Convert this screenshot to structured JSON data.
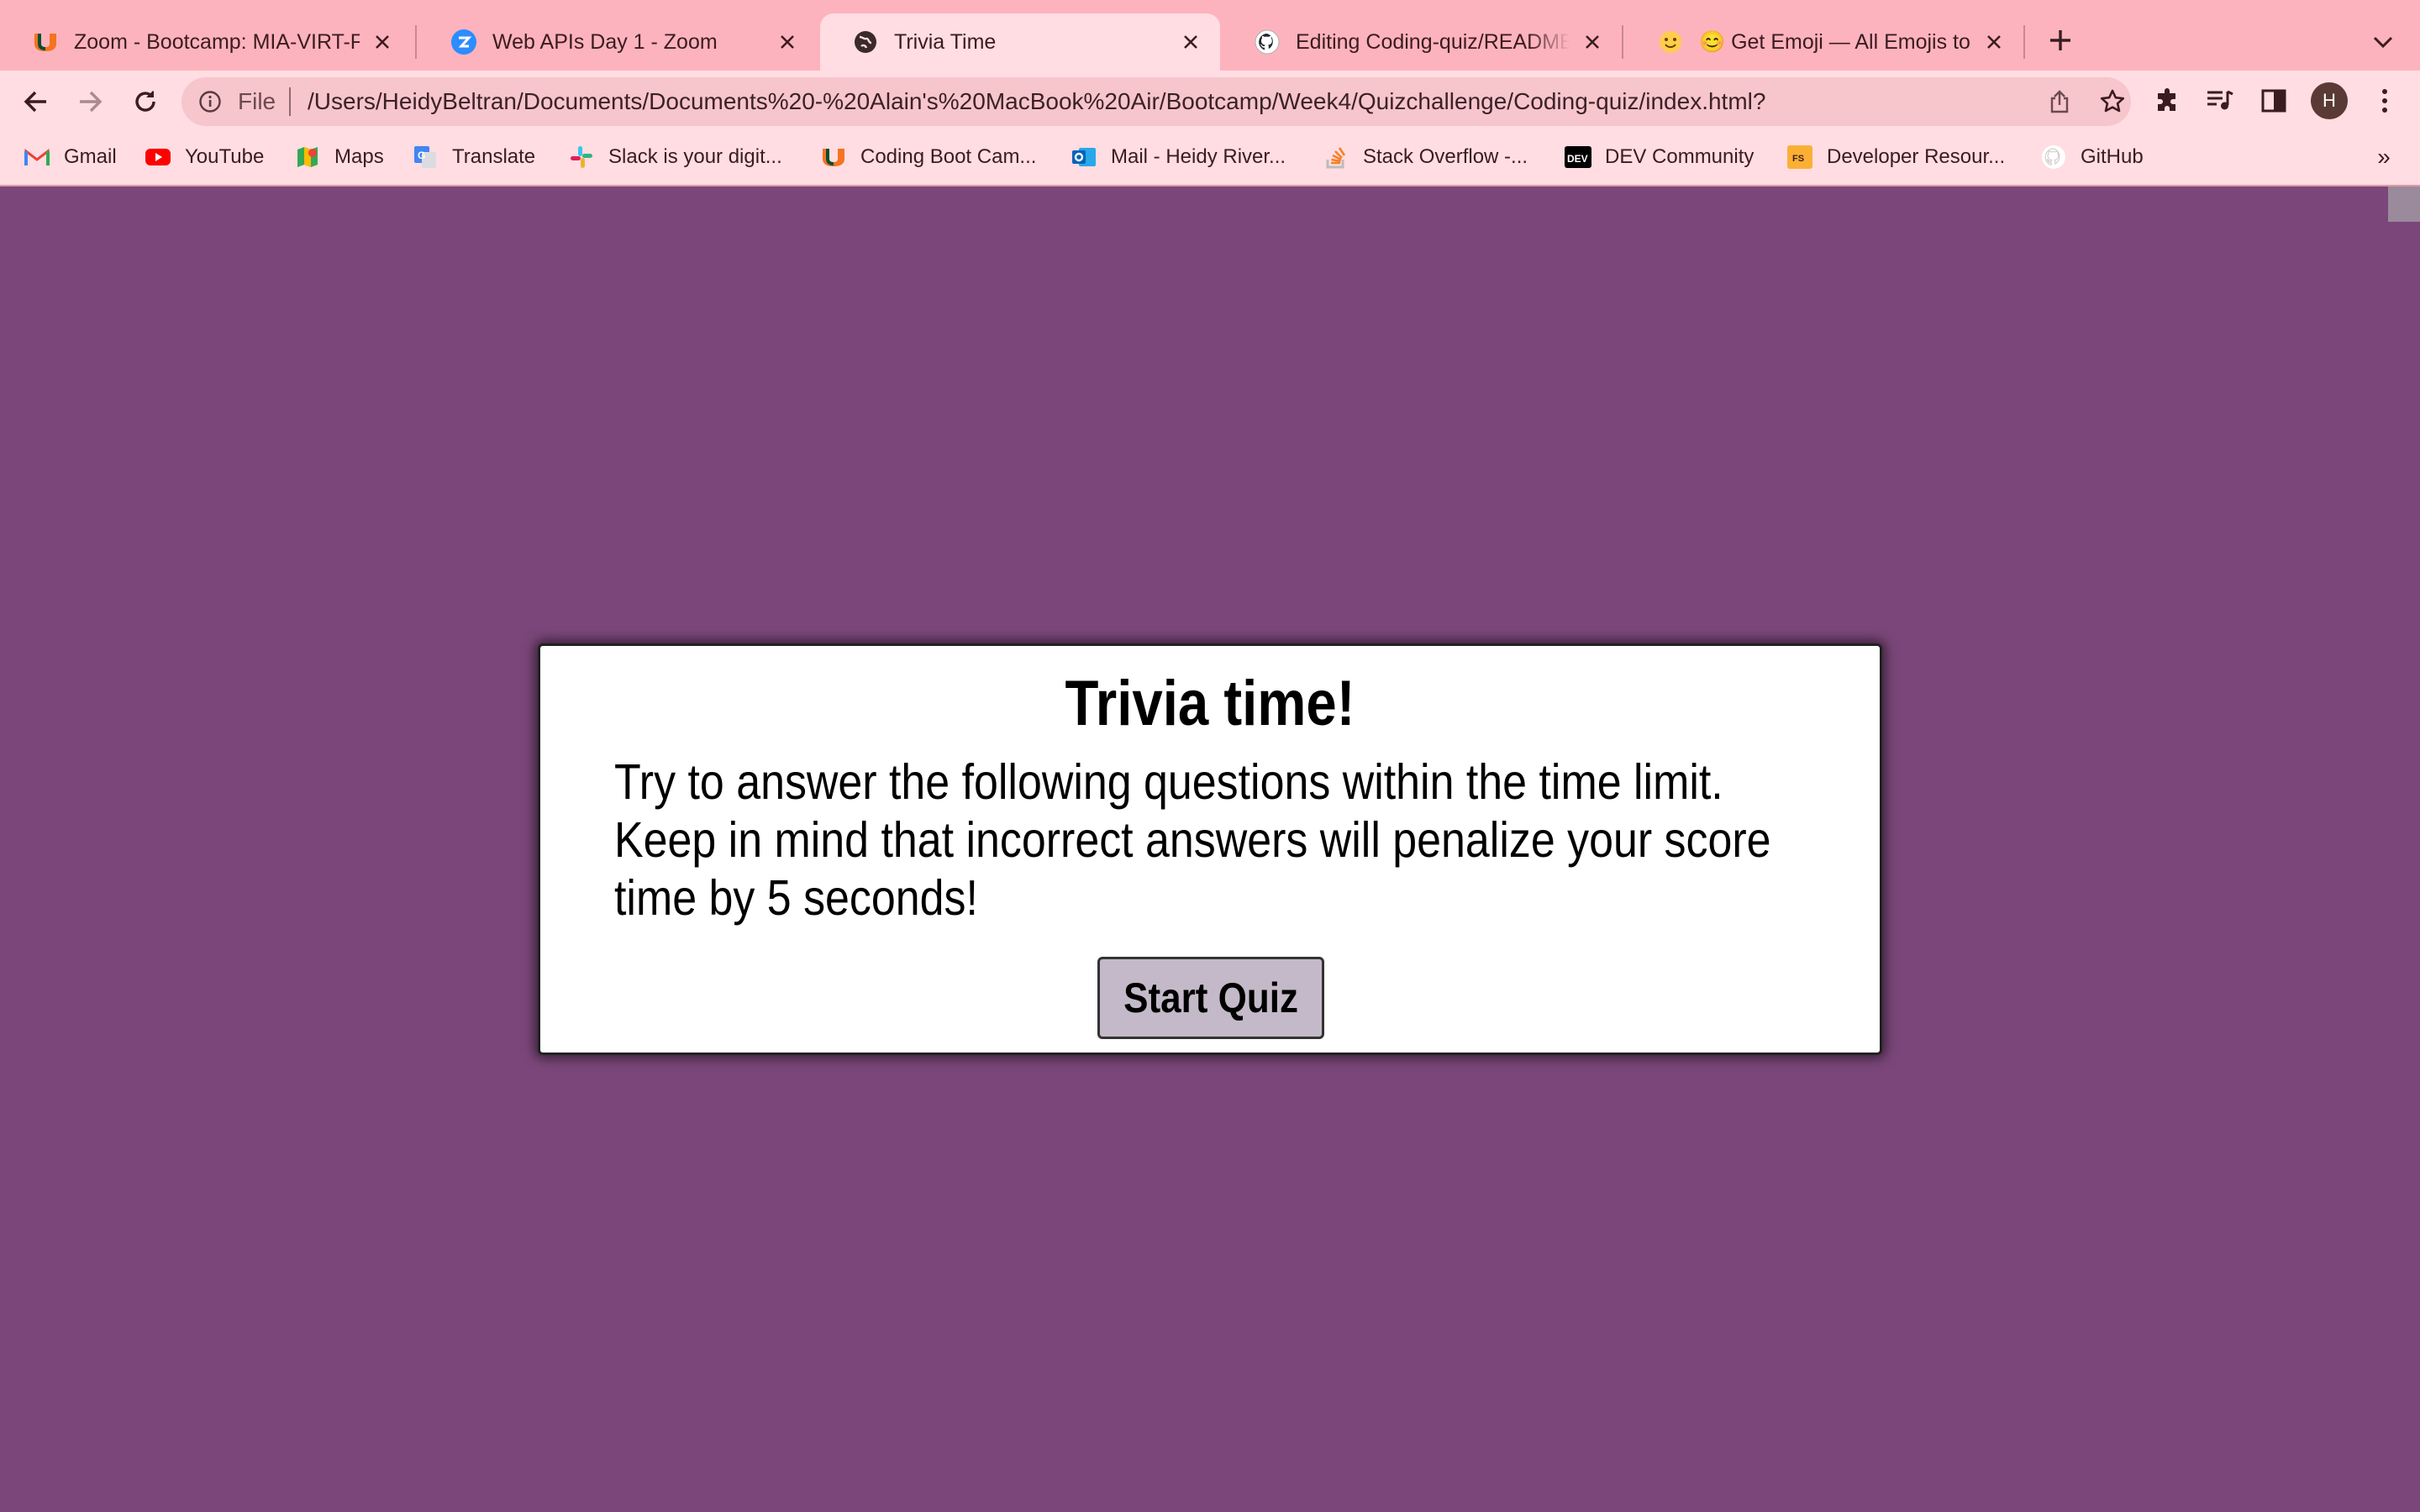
{
  "browser": {
    "tabs": [
      {
        "title": "Zoom - Bootcamp: MIA-VIRT-FSF-PT",
        "icon": "um-logo-icon"
      },
      {
        "title": "Web APIs Day 1 - Zoom",
        "icon": "zoom-logo-icon"
      },
      {
        "title": "Trivia Time",
        "icon": "globe-icon",
        "active": true
      },
      {
        "title": "Editing Coding-quiz/README.md",
        "icon": "github-logo-icon"
      },
      {
        "title": "😊 Get Emoji — All Emojis to ✂️",
        "icon": "smiley-emoji-icon"
      }
    ],
    "address_bar": {
      "scheme_label": "File",
      "url": "/Users/HeidyBeltran/Documents/Documents%20-%20Alain's%20MacBook%20Air/Bootcamp/Week4/Quizchallenge/Coding-quiz/index.html?"
    },
    "profile_initial": "H",
    "bookmarks": [
      {
        "label": "Gmail",
        "icon": "gmail-icon"
      },
      {
        "label": "YouTube",
        "icon": "youtube-icon"
      },
      {
        "label": "Maps",
        "icon": "maps-icon"
      },
      {
        "label": "Translate",
        "icon": "translate-icon"
      },
      {
        "label": "Slack is your digit...",
        "icon": "slack-icon"
      },
      {
        "label": "Coding Boot Cam...",
        "icon": "um-logo-icon"
      },
      {
        "label": "Mail - Heidy River...",
        "icon": "outlook-icon"
      },
      {
        "label": "Stack Overflow -...",
        "icon": "stackoverflow-icon"
      },
      {
        "label": "DEV Community",
        "icon": "dev-logo-icon"
      },
      {
        "label": "Developer Resour...",
        "icon": "fs-logo-icon"
      },
      {
        "label": "GitHub",
        "icon": "github-logo-icon"
      }
    ],
    "bookmarks_overflow": "»"
  },
  "quiz": {
    "title": "Trivia time!",
    "description": "Try to answer the following questions within the time limit. Keep in mind that incorrect answers will penalize your score time by 5 seconds!",
    "start_button_label": "Start Quiz"
  },
  "colors": {
    "page_background": "#7b477a",
    "tab_strip": "#fdb3bd",
    "toolbar": "#ffdde2",
    "card_background": "#ffffff",
    "button_background": "#c4b9c8"
  }
}
